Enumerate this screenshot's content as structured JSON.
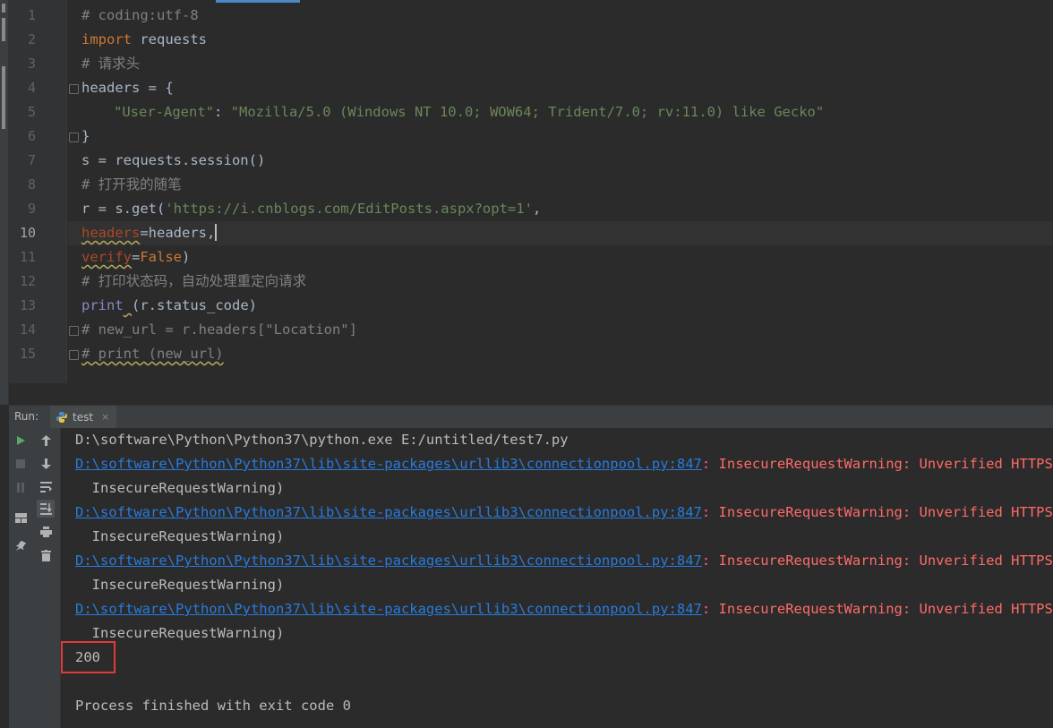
{
  "editor": {
    "line_numbers": [
      "1",
      "2",
      "3",
      "4",
      "5",
      "6",
      "7",
      "8",
      "9",
      "10",
      "11",
      "12",
      "13",
      "14",
      "15"
    ],
    "lines": {
      "l1": "# coding:utf-8",
      "l2_kw": "import",
      "l2_rest": " requests",
      "l3": "# 请求头",
      "l4": "headers = {",
      "l5_key": "\"User-Agent\"",
      "l5_colon": ": ",
      "l5_val": "\"Mozilla/5.0 (Windows NT 10.0; WOW64; Trident/7.0; rv:11.0) like Gecko\"",
      "l6": "}",
      "l7": "s = requests.session()",
      "l8": "# 打开我的随笔",
      "l9_pre": "r = s.get(",
      "l9_str": "'https://i.cnblogs.com/EditPosts.aspx?opt=1'",
      "l9_post": ",",
      "l10_param": "headers",
      "l10_rest": "=headers,",
      "l11_param": "verify",
      "l11_eq": "=",
      "l11_kw": "False",
      "l11_close": ")",
      "l12": "# 打印状态码，自动处理重定向请求",
      "l13_fn": "print",
      "l13_space": " ",
      "l13_rest": "(r.status_code)",
      "l14": "# new_url = r.headers[\"Location\"]",
      "l15": "# print (new_url)"
    }
  },
  "run_panel": {
    "label": "Run:",
    "tab_name": "test",
    "tab_close": "×"
  },
  "console": {
    "cmd": "D:\\software\\Python\\Python37\\python.exe E:/untitled/test7.py",
    "warning_link": "D:\\software\\Python\\Python37\\lib\\site-packages\\urllib3\\connectionpool.py:847",
    "warning_msg": ": InsecureRequestWarning: Unverified HTTPS requ",
    "warning_tail": "  InsecureRequestWarning)",
    "status_output": "200",
    "exit_msg": "Process finished with exit code 0"
  },
  "colors": {
    "comment": "#808080",
    "keyword": "#cc7832",
    "string": "#6a8759",
    "link": "#287bde",
    "error": "#ff6b68",
    "highlight_box": "#e03b3b"
  }
}
